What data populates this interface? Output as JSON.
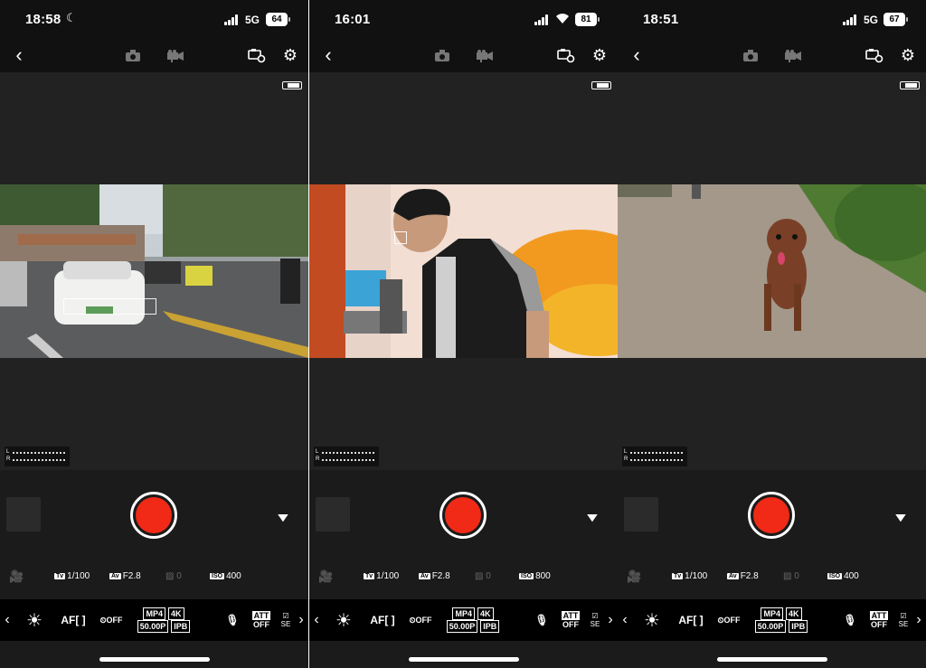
{
  "screens": [
    {
      "status": {
        "time": "18:58",
        "moon": "☾",
        "network": "5G",
        "battery": "64"
      },
      "params": {
        "tv": "1/100",
        "av": "F2.8",
        "ec": "0",
        "iso": "400"
      }
    },
    {
      "status": {
        "time": "16:01",
        "moon": "",
        "network": "",
        "battery": "81"
      },
      "params": {
        "tv": "1/100",
        "av": "F2.8",
        "ec": "0",
        "iso": "800"
      }
    },
    {
      "status": {
        "time": "18:51",
        "moon": "",
        "network": "5G",
        "battery": "67"
      },
      "params": {
        "tv": "1/100",
        "av": "F2.8",
        "ec": "0",
        "iso": "400"
      }
    }
  ],
  "labels": {
    "tv": "Tv",
    "av": "Av",
    "iso": "ISO",
    "af": "AF[ ]",
    "timer": "OFF",
    "fmt_mp4": "MP4",
    "fmt_4k": "4K",
    "fmt_fps": "50.00P",
    "fmt_ipb": "IPB",
    "att": "ATT",
    "att_off": "OFF",
    "se": "SE",
    "meter_l": "L",
    "meter_r": "R"
  },
  "icons": {
    "back": "chevron-left",
    "photo": "camera",
    "movie": "movie-camera",
    "camera_settings": "camera-gear",
    "settings": "gear",
    "white_balance": "sun",
    "mic": "microphone",
    "dropdown": "triangle-down"
  },
  "colors": {
    "record": "#f02a17",
    "background": "#1b1b1b",
    "bar": "#111111"
  }
}
